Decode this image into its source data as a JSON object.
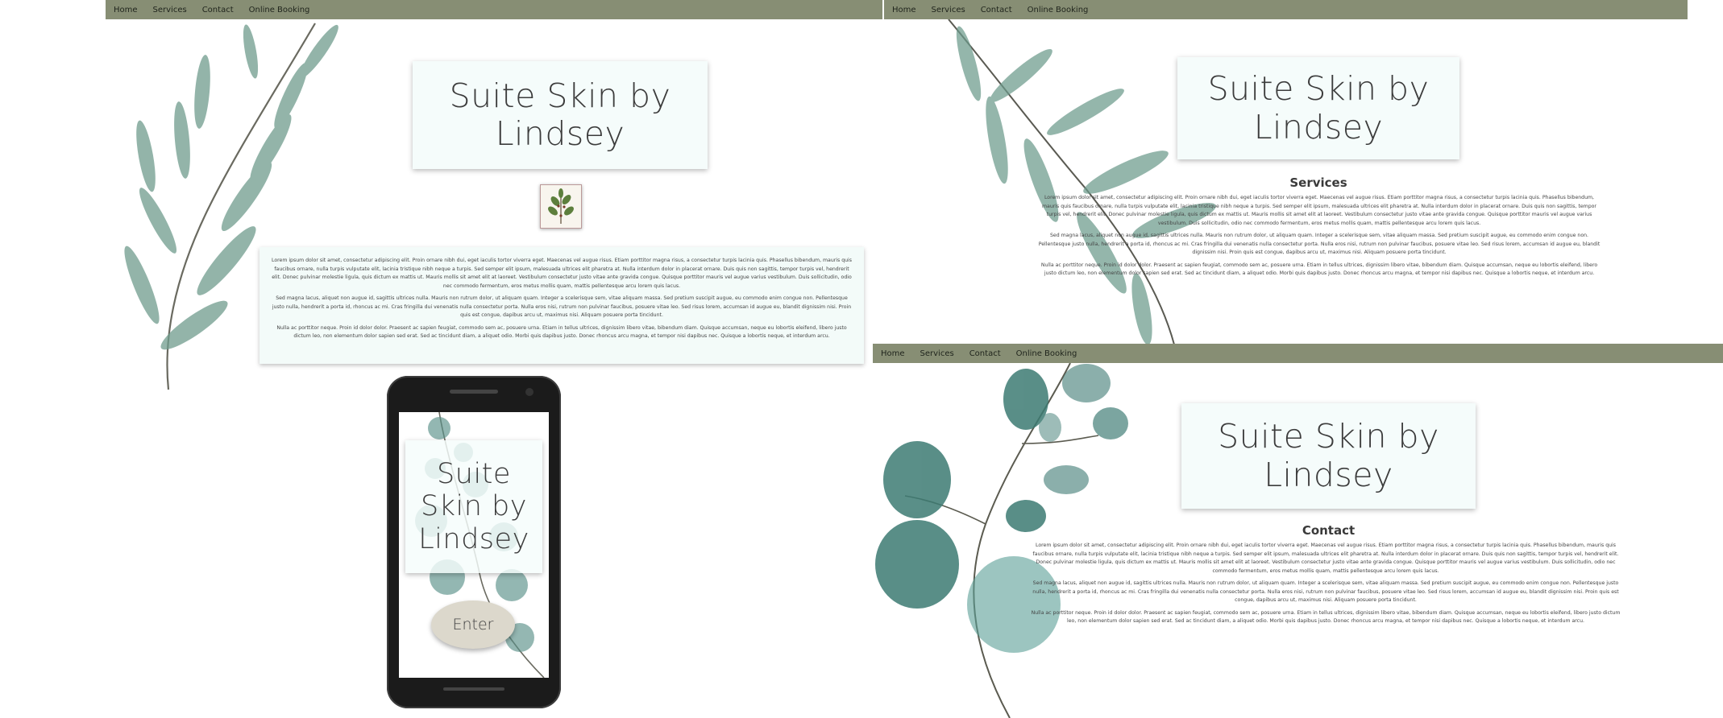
{
  "nav": {
    "items": [
      "Home",
      "Services",
      "Contact",
      "Online Booking"
    ]
  },
  "site_title": "Suite Skin by Lindsey",
  "title_lines": {
    "line1": "Suite Skin by",
    "line2": "Lindsey"
  },
  "mobile_title": {
    "line1": "Suite",
    "line2": "Skin by",
    "line3": "Lindsey"
  },
  "mobile_enter": "Enter",
  "services": {
    "heading": "Services"
  },
  "contact": {
    "heading": "Contact"
  },
  "lorem": {
    "p1": "Lorem ipsum dolor sit amet, consectetur adipiscing elit. Proin ornare nibh dui, eget iaculis tortor viverra eget. Maecenas vel augue risus. Etiam porttitor magna risus, a consectetur turpis lacinia quis. Phasellus bibendum, mauris quis faucibus ornare, nulla turpis vulputate elit, lacinia tristique nibh neque a turpis. Sed semper elit ipsum, malesuada ultrices elit pharetra at. Nulla interdum dolor in placerat ornare. Duis quis non sagittis, tempor turpis vel, hendrerit elit. Donec pulvinar molestie ligula, quis dictum ex mattis ut. Mauris mollis sit amet elit at laoreet. Vestibulum consectetur justo vitae ante gravida congue. Quisque porttitor mauris vel augue varius vestibulum. Duis sollicitudin, odio nec commodo fermentum, eros metus mollis quam, mattis pellentesque arcu lorem quis lacus.",
    "p2": "Sed magna lacus, aliquet non augue id, sagittis ultrices nulla. Mauris non rutrum dolor, ut aliquam quam. Integer a scelerisque sem, vitae aliquam massa. Sed pretium suscipit augue, eu commodo enim congue non. Pellentesque justo nulla, hendrerit a porta id, rhoncus ac mi. Cras fringilla dui venenatis nulla consectetur porta. Nulla eros nisi, rutrum non pulvinar faucibus, posuere vitae leo. Sed risus lorem, accumsan id augue eu, blandit dignissim nisi. Proin quis est congue, dapibus arcu ut, maximus nisi. Aliquam posuere porta tincidunt.",
    "p3": "Nulla ac porttitor neque. Proin id dolor dolor. Praesent ac sapien feugiat, commodo sem ac, posuere urna. Etiam in tellus ultrices, dignissim libero vitae, bibendum diam. Quisque accumsan, neque eu lobortis eleifend, libero justo dictum leo, non elementum dolor sapien sed erat. Sed ac tincidunt diam, a aliquet odio. Morbi quis dapibus justo. Donec rhoncus arcu magna, et tempor nisi dapibus nec. Quisque a lobortis neque, et interdum arcu."
  },
  "colors": {
    "nav": "#878e74",
    "title_box": "#f5fcfb",
    "leaf": "#5e8f7f",
    "eucalyptus": "#3f7a72"
  },
  "icons": [
    "willow-leaf-branch-icon",
    "eucalyptus-branch-icon",
    "herb-thumbnail-icon"
  ]
}
